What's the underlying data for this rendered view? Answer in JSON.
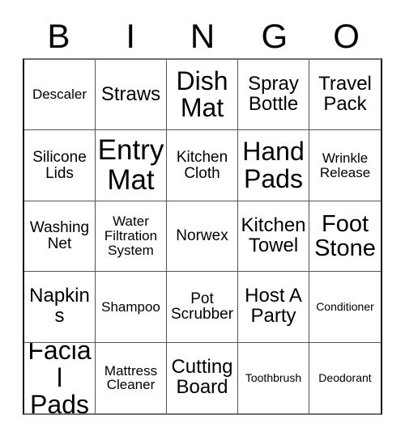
{
  "card": {
    "title": "BINGO",
    "header_letters": [
      "B",
      "I",
      "N",
      "G",
      "O"
    ],
    "columns": 5,
    "rows": 5,
    "colors": {
      "background": "#ffffff",
      "text": "#000000",
      "grid_line": "#555555",
      "outer_border": "#111111"
    },
    "cells": [
      {
        "text": "Descaler",
        "size": "fs-xs"
      },
      {
        "text": "Straws",
        "size": "fs-md"
      },
      {
        "text": "Dish Mat",
        "size": "fs-xl"
      },
      {
        "text": "Spray Bottle",
        "size": "fs-md"
      },
      {
        "text": "Travel Pack",
        "size": "fs-md"
      },
      {
        "text": "Silicone Lids",
        "size": "fs-sm"
      },
      {
        "text": "Entry Mat",
        "size": "fs-xxl"
      },
      {
        "text": "Kitchen Cloth",
        "size": "fs-sm"
      },
      {
        "text": "Hand Pads",
        "size": "fs-xl"
      },
      {
        "text": "Wrinkle Release",
        "size": "fs-xs"
      },
      {
        "text": "Washing Net",
        "size": "fs-sm"
      },
      {
        "text": "Water Filtration System",
        "size": "fs-xs"
      },
      {
        "text": "Norwex",
        "size": "fs-sm"
      },
      {
        "text": "Kitchen Towel",
        "size": "fs-md"
      },
      {
        "text": "Foot Stone",
        "size": "fs-lg"
      },
      {
        "text": "Napkins",
        "size": "fs-md"
      },
      {
        "text": "Shampoo",
        "size": "fs-xs"
      },
      {
        "text": "Pot Scrubber",
        "size": "fs-sm"
      },
      {
        "text": "Host A Party",
        "size": "fs-md"
      },
      {
        "text": "Conditioner",
        "size": "fs-xxs"
      },
      {
        "text": "Facial Pads",
        "size": "fs-xl"
      },
      {
        "text": "Mattress Cleaner",
        "size": "fs-xs"
      },
      {
        "text": "Cutting Board",
        "size": "fs-md"
      },
      {
        "text": "Toothbrush",
        "size": "fs-xxs"
      },
      {
        "text": "Deodorant",
        "size": "fs-xxs"
      }
    ]
  }
}
